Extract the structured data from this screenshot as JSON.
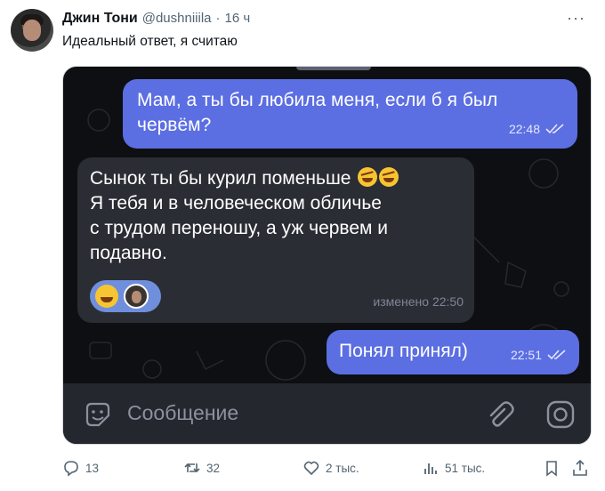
{
  "tweet": {
    "author_name": "Джин Тони",
    "handle": "@dushniiila",
    "separator": "·",
    "time": "16 ч",
    "more": "···",
    "text": "Идеальный ответ, я считаю"
  },
  "chat": {
    "messages": [
      {
        "text": "Мам, а ты бы любила меня, если б я был червём?",
        "time": "22:48"
      },
      {
        "text_lines": [
          "Сынок ты бы курил поменьше",
          "Я тебя и в человеческом обличье",
          "с трудом переношу, а уж червем и",
          "подавно."
        ],
        "time": "изменено 22:50"
      },
      {
        "text": "Понял принял)",
        "time": "22:51"
      }
    ],
    "input_placeholder": "Сообщение"
  },
  "actions": {
    "replies": "13",
    "retweets": "32",
    "likes": "2 тыс.",
    "views": "51 тыс."
  },
  "colors": {
    "outgoing_bubble": "#5b6ee2",
    "incoming_bubble": "#2b2d34",
    "chat_bg": "#0e0f12",
    "muted_text": "#536471"
  }
}
